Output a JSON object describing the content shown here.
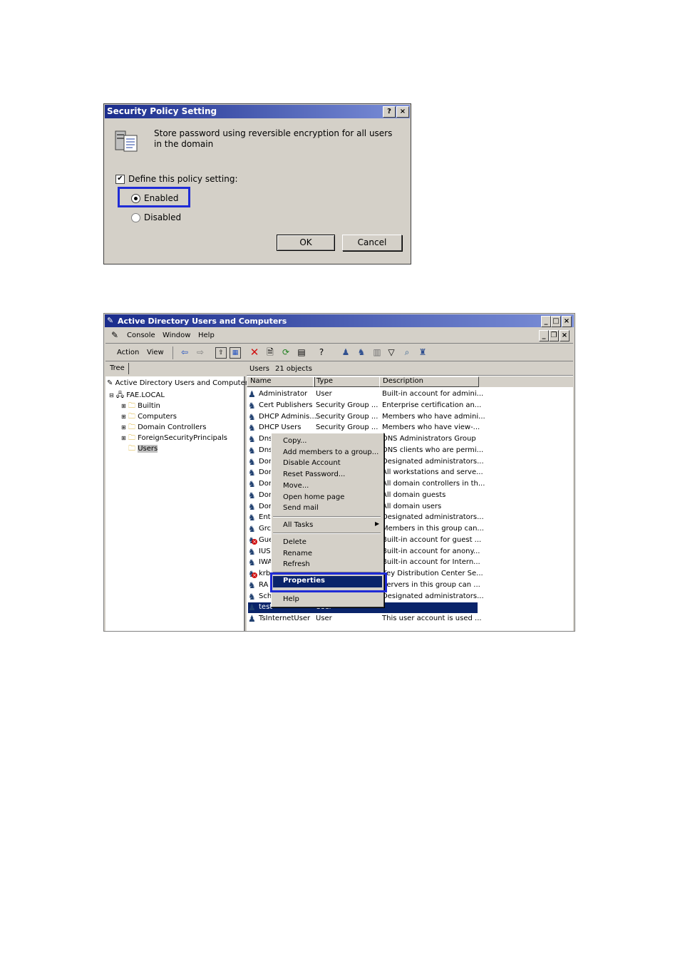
{
  "dialog": {
    "title": "Security Policy Setting",
    "help_btn": "?",
    "close_btn": "×",
    "description": "Store password using reversible encryption for all users in the domain",
    "define_label": "Define this policy setting:",
    "define_checked": true,
    "enabled_label": "Enabled",
    "disabled_label": "Disabled",
    "selected": "Enabled",
    "ok_label": "OK",
    "cancel_label": "Cancel",
    "highlight_color": "#1f2bd6"
  },
  "aduc": {
    "title": "Active Directory Users and Computers",
    "menu": {
      "console": "Console",
      "window": "Window",
      "help": "Help"
    },
    "action_menu": {
      "action": "Action",
      "view": "View"
    },
    "tree_tab": "Tree",
    "tree": {
      "root": "Active Directory Users and Computers",
      "domain": "FAE.LOCAL",
      "children": [
        "Builtin",
        "Computers",
        "Domain Controllers",
        "ForeignSecurityPrincipals",
        "Users"
      ]
    },
    "list_header": {
      "container": "Users",
      "count": "21 objects"
    },
    "columns": [
      "Name",
      "Type",
      "Description"
    ],
    "rows": [
      {
        "name": "Administrator",
        "type": "User",
        "desc": "Built-in account for admini..."
      },
      {
        "name": "Cert Publishers",
        "type": "Security Group ...",
        "desc": "Enterprise certification an..."
      },
      {
        "name": "DHCP Adminis...",
        "type": "Security Group ...",
        "desc": "Members who have admini..."
      },
      {
        "name": "DHCP Users",
        "type": "Security Group ...",
        "desc": "Members who have view-..."
      },
      {
        "name": "Dns",
        "type": "",
        "desc": "DNS Administrators Group"
      },
      {
        "name": "Dns",
        "type": "",
        "desc": "DNS clients who are permi..."
      },
      {
        "name": "Dor",
        "type": "",
        "desc": "Designated administrators..."
      },
      {
        "name": "Dor",
        "type": "",
        "desc": "All workstations and serve..."
      },
      {
        "name": "Dor",
        "type": "",
        "desc": "All domain controllers in th..."
      },
      {
        "name": "Dor",
        "type": "",
        "desc": "All domain guests"
      },
      {
        "name": "Dor",
        "type": "",
        "desc": "All domain users"
      },
      {
        "name": "Ent",
        "type": "",
        "desc": "Designated administrators..."
      },
      {
        "name": "Grc",
        "type": "",
        "desc": "Members in this group can..."
      },
      {
        "name": "Gue",
        "type": "",
        "desc": "Built-in account for guest ..."
      },
      {
        "name": "IUS",
        "type": "",
        "desc": "Built-in account for anony..."
      },
      {
        "name": "IWA",
        "type": "",
        "desc": "Built-in account for Intern..."
      },
      {
        "name": "krb",
        "type": "",
        "desc": "Key Distribution Center Se..."
      },
      {
        "name": "RA",
        "type": "",
        "desc": "Servers in this group can ..."
      },
      {
        "name": "Sch",
        "type": "",
        "desc": "Designated administrators..."
      },
      {
        "name": "test",
        "type": "User",
        "desc": ""
      },
      {
        "name": "TsInternetUser",
        "type": "User",
        "desc": "This user account is used ..."
      }
    ],
    "context_menu": {
      "items": [
        "Copy...",
        "Add members to a group...",
        "Disable Account",
        "Reset Password...",
        "Move...",
        "Open home page",
        "Send mail"
      ],
      "all_tasks": "All Tasks",
      "items2": [
        "Delete",
        "Rename",
        "Refresh"
      ],
      "properties": "Properties",
      "help": "Help"
    }
  }
}
